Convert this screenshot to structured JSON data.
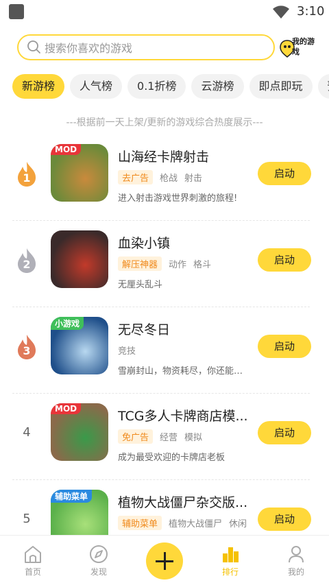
{
  "status_bar": {
    "time": "3:10"
  },
  "search": {
    "placeholder": "搜索你喜欢的游戏",
    "my_games_label": "我的游戏"
  },
  "tabs": [
    "新游榜",
    "人气榜",
    "0.1折榜",
    "云游榜",
    "即点即玩",
    "预约"
  ],
  "active_tab": "新游榜",
  "subtitle": "---根据前一天上架/更新的游戏综合热度展示---",
  "games": [
    {
      "rank": "1",
      "title": "山海经卡牌射击",
      "corner_tag": "MOD",
      "highlight_tag": "去广告",
      "tags": [
        "枪战",
        "射击"
      ],
      "description": "进入射击游戏世界刺激的旅程!",
      "button": "启动",
      "icon_colors": {
        "bg": "#6b8a3a",
        "accent": "#c98a3c"
      }
    },
    {
      "rank": "2",
      "title": "血染小镇",
      "corner_tag": "",
      "highlight_tag": "解压神器",
      "tags": [
        "动作",
        "格斗"
      ],
      "description": "无厘头乱斗",
      "button": "启动",
      "icon_colors": {
        "bg": "#3a2a2a",
        "accent": "#c23a2a"
      }
    },
    {
      "rank": "3",
      "title": "无尽冬日",
      "corner_tag": "小游戏",
      "highlight_tag": "",
      "tags": [
        "竞技"
      ],
      "description": "雪崩封山，物资耗尽，你还能撑...",
      "button": "启动",
      "icon_colors": {
        "bg": "#1f4f8a",
        "accent": "#b8d8f0"
      }
    },
    {
      "rank": "4",
      "title": "TCG多人卡牌商店模...",
      "corner_tag": "MOD",
      "highlight_tag": "免广告",
      "tags": [
        "经营",
        "模拟"
      ],
      "description": "成为最受欢迎的卡牌店老板",
      "button": "启动",
      "icon_colors": {
        "bg": "#8a6a4a",
        "accent": "#3a9a4a"
      }
    },
    {
      "rank": "5",
      "title": "植物大战僵尸杂交版...",
      "corner_tag": "辅助菜单",
      "highlight_tag": "辅助菜单",
      "tags": [
        "植物大战僵尸",
        "休闲"
      ],
      "description": "",
      "button": "启动",
      "icon_colors": {
        "bg": "#5ab04a",
        "accent": "#a8e07a"
      }
    }
  ],
  "bottom_nav": {
    "items": [
      {
        "label": "首页",
        "icon": "home-icon"
      },
      {
        "label": "发现",
        "icon": "compass-icon"
      },
      {
        "label": "排行",
        "icon": "ranking-icon"
      },
      {
        "label": "我的",
        "icon": "profile-icon"
      }
    ],
    "active": "排行"
  },
  "colors": {
    "accent": "#ffd83a",
    "highlight_text": "#f08a1c",
    "rank1": "#f3a23c",
    "rank2": "#b0b0b8",
    "rank3": "#e07a5a"
  }
}
